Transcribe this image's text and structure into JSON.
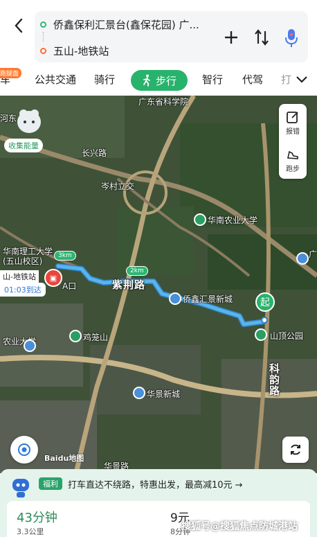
{
  "header": {
    "origin": "侨鑫保利汇景台(鑫保花园) 广...",
    "destination": "五山-地铁站"
  },
  "tabs": [
    {
      "label": "车",
      "badge": "跑腿面"
    },
    {
      "label": "公共交通"
    },
    {
      "label": "骑行"
    },
    {
      "label": "步行",
      "active": true
    },
    {
      "label": "智行"
    },
    {
      "label": "代驾"
    },
    {
      "label": "打"
    }
  ],
  "map": {
    "labels": {
      "academy": "广东省科学院",
      "changxing": "长兴路",
      "cencun": "岑村立交",
      "scau": "华南农业大学",
      "scut": "华南理工大学(五山校区)",
      "zijing": "紫荆路",
      "qiaoxin": "侨鑫汇景新城",
      "shanding": "山顶公园",
      "jilong": "鸡笼山",
      "huajing": "华景新城",
      "keyun": "科韵路",
      "nongye": "农业大学",
      "hualong": "华景路",
      "hewan": "河东",
      "guang": "广"
    },
    "distances": [
      "3km",
      "2km"
    ],
    "start_label": "起",
    "end_name": "山-地铁站",
    "arrive_time": "01:03到达",
    "exit_label": "A口",
    "energy_label": "收集能量",
    "baidu_logo": "Baidu地图",
    "tools": [
      {
        "label": "报错",
        "icon": "edit-icon"
      },
      {
        "label": "跑步",
        "icon": "running-shoe-icon"
      }
    ],
    "route_color": "#5ab4ea"
  },
  "sheet": {
    "promo_badge": "福利",
    "promo_text": "打车直达不绕路，特惠出发，最高减10元 →",
    "time": "43分钟",
    "distance": "3.3公里",
    "price": "9元",
    "price_sub": "8分钟"
  },
  "watermark": "搜狐号@搜狐焦点防城港站"
}
